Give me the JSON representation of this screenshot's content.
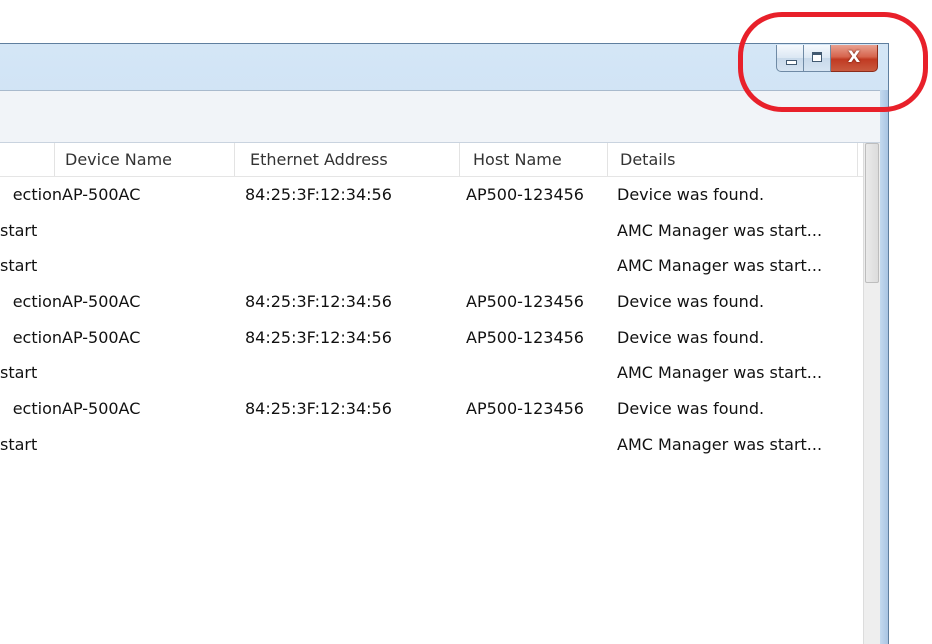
{
  "window": {
    "caption_buttons": {
      "minimize_icon": "minimize-icon",
      "maximize_icon": "maximize-icon",
      "close_label": "X"
    }
  },
  "table": {
    "columns": [
      "",
      "Device Name",
      "Ethernet Address",
      "Host Name",
      "Details"
    ],
    "rows": [
      {
        "event": "ection",
        "device": "AP-500AC",
        "ethernet": "84:25:3F:12:34:56",
        "host": "AP500-123456",
        "details": "Device was found."
      },
      {
        "event": "start",
        "device": "",
        "ethernet": "",
        "host": "",
        "details": "AMC Manager was start..."
      },
      {
        "event": "start",
        "device": "",
        "ethernet": "",
        "host": "",
        "details": "AMC Manager was start..."
      },
      {
        "event": "ection",
        "device": "AP-500AC",
        "ethernet": "84:25:3F:12:34:56",
        "host": "AP500-123456",
        "details": "Device was found."
      },
      {
        "event": "ection",
        "device": "AP-500AC",
        "ethernet": "84:25:3F:12:34:56",
        "host": "AP500-123456",
        "details": "Device was found."
      },
      {
        "event": "start",
        "device": "",
        "ethernet": "",
        "host": "",
        "details": "AMC Manager was start..."
      },
      {
        "event": "ection",
        "device": "AP-500AC",
        "ethernet": "84:25:3F:12:34:56",
        "host": "AP500-123456",
        "details": "Device was found."
      },
      {
        "event": "start",
        "device": "",
        "ethernet": "",
        "host": "",
        "details": "AMC Manager was start..."
      }
    ]
  },
  "colors": {
    "highlight": "#e8202a",
    "title_bar": "#c4dbf1",
    "close_button": "#c13a22"
  }
}
